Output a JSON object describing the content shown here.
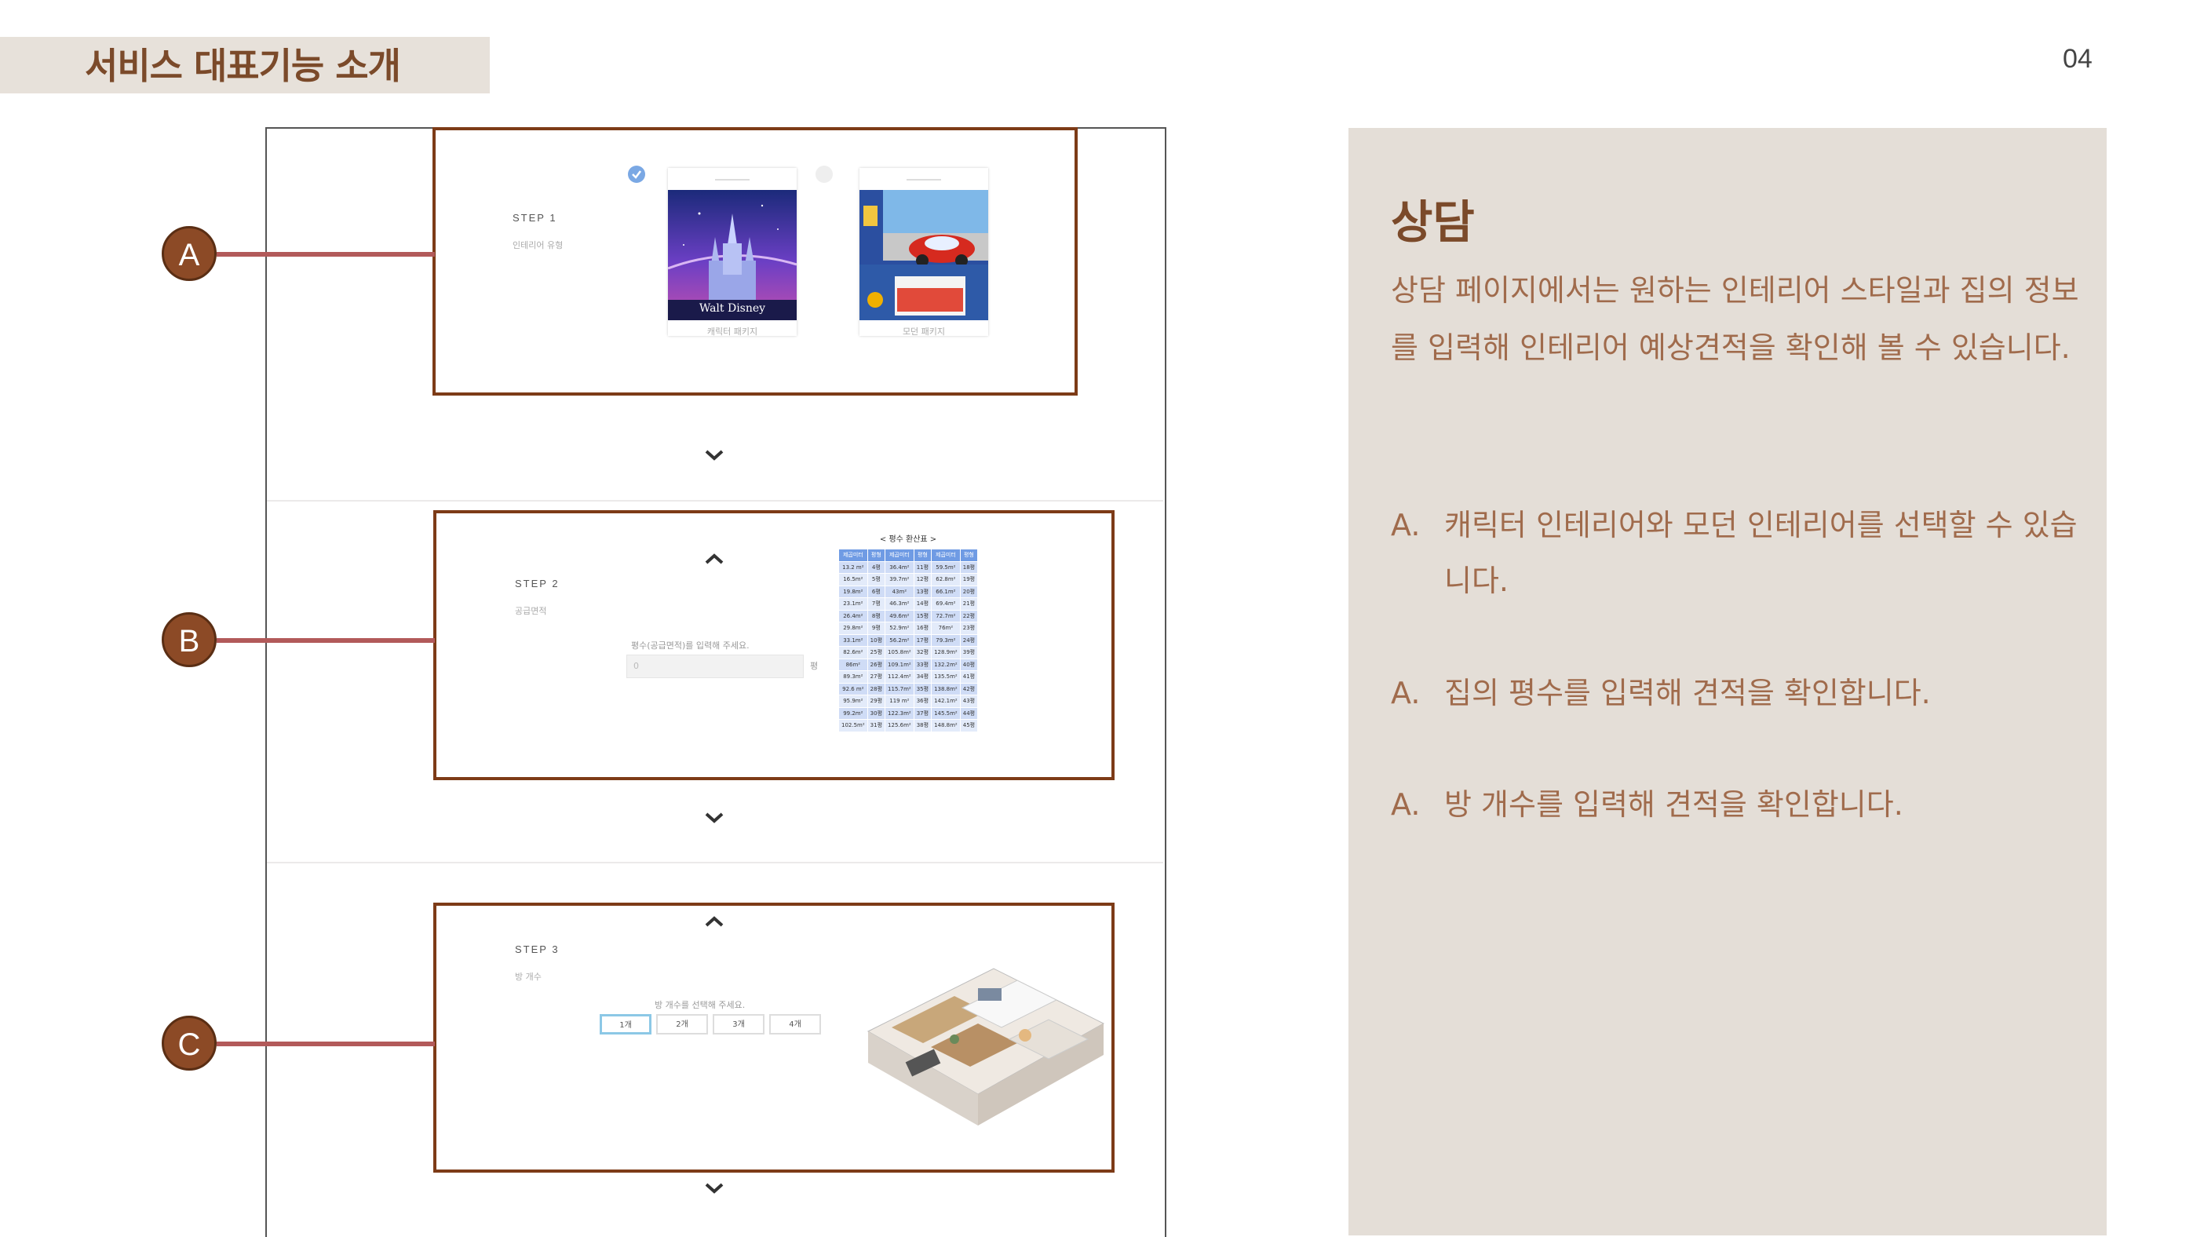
{
  "header": {
    "title": "서비스 대표기능 소개",
    "page_number": "04"
  },
  "screenshot": {
    "markers": [
      "A",
      "B",
      "C"
    ],
    "step1": {
      "title": "STEP 1",
      "subtitle": "인테리어 유형",
      "options": [
        {
          "label": "캐릭터 패키지",
          "selected": true
        },
        {
          "label": "모던 패키지",
          "selected": false
        }
      ]
    },
    "step2": {
      "title": "STEP 2",
      "subtitle": "공급면적",
      "input_hint": "평수(공급면적)를 입력해 주세요.",
      "input_placeholder": "0",
      "unit": "평",
      "table_title": "< 평수 환산표 >",
      "table_headers": [
        "제곱미터",
        "평형",
        "제곱미터",
        "평형",
        "제곱미터",
        "평형"
      ],
      "table_rows": [
        [
          "13.2 m²",
          "4평",
          "36.4m²",
          "11평",
          "59.5m²",
          "18평"
        ],
        [
          "16.5m²",
          "5평",
          "39.7m²",
          "12평",
          "62.8m²",
          "19평"
        ],
        [
          "19.8m²",
          "6평",
          "43m²",
          "13평",
          "66.1m²",
          "20평"
        ],
        [
          "23.1m²",
          "7평",
          "46.3m²",
          "14평",
          "69.4m²",
          "21평"
        ],
        [
          "26.4m²",
          "8평",
          "49.6m²",
          "15평",
          "72.7m²",
          "22평"
        ],
        [
          "29.8m²",
          "9평",
          "52.9m²",
          "16평",
          "76m²",
          "23평"
        ],
        [
          "33.1m²",
          "10평",
          "56.2m²",
          "17평",
          "79.3m²",
          "24평"
        ],
        [
          "82.6m²",
          "25평",
          "105.8m²",
          "32평",
          "128.9m²",
          "39평"
        ],
        [
          "86m²",
          "26평",
          "109.1m²",
          "33평",
          "132.2m²",
          "40평"
        ],
        [
          "89.3m²",
          "27평",
          "112.4m²",
          "34평",
          "135.5m²",
          "41평"
        ],
        [
          "92.6 m²",
          "28평",
          "115.7m²",
          "35평",
          "138.8m²",
          "42평"
        ],
        [
          "95.9m²",
          "29평",
          "119 m²",
          "36평",
          "142.1m²",
          "43평"
        ],
        [
          "99.2m²",
          "30평",
          "122.3m²",
          "37평",
          "145.5m²",
          "44평"
        ],
        [
          "102.5m²",
          "31평",
          "125.6m²",
          "38평",
          "148.8m²",
          "45평"
        ]
      ]
    },
    "step3": {
      "title": "STEP 3",
      "subtitle": "방 개수",
      "hint": "방 개수를 선택해 주세요.",
      "buttons": [
        "1개",
        "2개",
        "3개",
        "4개"
      ],
      "selected": "1개"
    }
  },
  "panel": {
    "heading": "상담",
    "description": " 상담 페이지에서는 원하는 인테리어 스타일과 집의 정보를 입력해 인테리어 예상견적을 확인해 볼 수 있습니다.",
    "items": [
      {
        "label": "A.",
        "text": "캐릭터 인테리어와 모던 인테리어를 선택할 수 있습니다."
      },
      {
        "label": "A.",
        "text": "집의 평수를 입력해 견적을 확인합니다."
      },
      {
        "label": "A.",
        "text": "방 개수를 입력해 견적을 확인합니다."
      }
    ]
  },
  "colors": {
    "accent": "#7b4a2a",
    "panel_bg": "#e4ded7",
    "marker": "#8c4a26",
    "connector": "#b25a5a",
    "box_border": "#7d3b17"
  }
}
